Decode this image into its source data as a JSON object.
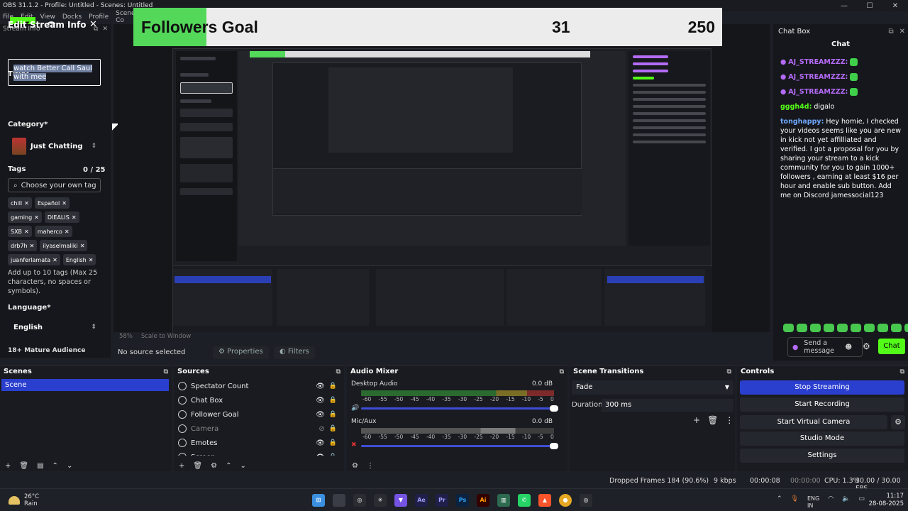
{
  "window": {
    "title": "OBS 31.1.2 - Profile: Untitled - Scenes: Untitled"
  },
  "menu": [
    "File",
    "Edit",
    "View",
    "Docks",
    "Profile",
    "Scene Co"
  ],
  "overlay": {
    "goal_label": "Followers Goal",
    "goal_current": "31",
    "goal_target": "250",
    "goal_progress_fraction": 0.124,
    "kick_logo": "K",
    "kick_count": "0"
  },
  "stream_info": {
    "dock_title": "Stream Info",
    "heading": "Edit Stream Info",
    "title_label": "Title*",
    "title_value": "watch Better Call Saul with mee",
    "category_label": "Category*",
    "category_value": "Just Chatting",
    "tags_label": "Tags",
    "tags_count": "0 / 25",
    "tags_placeholder": "Choose your own tag",
    "tags": [
      "chill",
      "Español",
      "gaming",
      "DIEALIS",
      "SXB",
      "maherco",
      "drb7h",
      "ilyaselmaliki",
      "juanferlamata",
      "English"
    ],
    "tags_help": "Add up to 10 tags (Max 25 characters, no spaces or symbols).",
    "language_label": "Language*",
    "language_value": "English",
    "mature_label": "18+ Mature Audience"
  },
  "preview": {
    "zoom": "58%",
    "scale_mode": "Scale to Window"
  },
  "source_bar": {
    "no_source": "No source selected",
    "properties": "Properties",
    "filters": "Filters"
  },
  "chat": {
    "dock_title": "Chat Box",
    "title": "Chat",
    "messages": [
      {
        "user": "AJ_STREAMZZZ:",
        "text": "",
        "color": "#b36bf6"
      },
      {
        "user": "AJ_STREAMZZZ:",
        "text": "",
        "color": "#b36bf6"
      },
      {
        "user": "AJ_STREAMZZZ:",
        "text": "",
        "color": "#b36bf6"
      },
      {
        "user": "gggh4d:",
        "text": "digalo",
        "color": "#53fc18"
      },
      {
        "user": "tonghappy:",
        "text": "Hey homie, I checked your videos seems like you are new in kick not yet affilliated and verified. I got a proposal for you by sharing your stream to a kick community for you to gain 1000+ followers , earning at least $16 per hour and enable sub button. Add me on Discord jamessocial123",
        "color": "#6fa8ff"
      }
    ],
    "send_placeholder": "Send a message",
    "send_button": "Chat"
  },
  "scenes": {
    "title": "Scenes",
    "items": [
      "Scene"
    ]
  },
  "sources": {
    "title": "Sources",
    "items": [
      {
        "name": "Spectator Count",
        "visible": true
      },
      {
        "name": "Chat Box",
        "visible": true
      },
      {
        "name": "Follower Goal",
        "visible": true
      },
      {
        "name": "Camera",
        "visible": false
      },
      {
        "name": "Emotes",
        "visible": true
      },
      {
        "name": "Screen",
        "visible": true
      }
    ]
  },
  "mixer": {
    "title": "Audio Mixer",
    "channels": [
      {
        "name": "Desktop Audio",
        "db": "0.0 dB"
      },
      {
        "name": "Mic/Aux",
        "db": "0.0 dB"
      }
    ],
    "scale": [
      "-60",
      "-55",
      "-50",
      "-45",
      "-40",
      "-35",
      "-30",
      "-25",
      "-20",
      "-15",
      "-10",
      "-5",
      "0"
    ]
  },
  "transitions": {
    "title": "Scene Transitions",
    "selected": "Fade",
    "duration_label": "Duration",
    "duration_value": "300 ms"
  },
  "controls": {
    "title": "Controls",
    "stop_streaming": "Stop Streaming",
    "start_recording": "Start Recording",
    "start_virtual_camera": "Start Virtual Camera",
    "studio_mode": "Studio Mode",
    "settings": "Settings"
  },
  "status": {
    "dropped_frames": "Dropped Frames 184 (90.6%)",
    "bitrate": "9 kbps",
    "stream_time": "00:00:08",
    "rec_time": "00:00:00",
    "cpu": "CPU: 1.3%",
    "fps": "30.00 / 30.00 FPS"
  },
  "taskbar": {
    "temp": "26°C",
    "weather": "Rain",
    "lang": "ENG",
    "region": "IN",
    "time": "11:17",
    "date": "28-08-2025"
  },
  "colors": {
    "accent": "#2b3fcf",
    "kick_green": "#53fc18",
    "goal_green": "#53d85a"
  }
}
